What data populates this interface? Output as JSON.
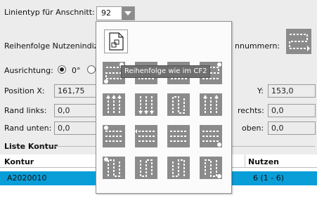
{
  "labels": {
    "linientyp": "Linientyp für Anschnitt:",
    "reihenfolge": "Reihenfolge Nutzenindiz",
    "nummern": "nnummern:",
    "ausrichtung": "Ausrichtung:",
    "radio_0": "0°",
    "position_x": "Position X:",
    "y": "Y:",
    "rand_links": "Rand links:",
    "rand_rechts": "rechts:",
    "rand_unten": "Rand unten:",
    "rand_oben": "oben:",
    "liste_kontur": "Liste Kontur"
  },
  "combo": {
    "value": "92"
  },
  "fields": {
    "position_x": "161,75",
    "y": "153,0",
    "rand_links": "0,0",
    "rand_rechts": "0,0",
    "rand_unten": "0,0",
    "rand_oben": "0,0"
  },
  "tooltip": "Reihenfolge wie im CF2",
  "table": {
    "headers": [
      "Kontur",
      "Nutzen"
    ],
    "rows": [
      {
        "kontur": "A2020010",
        "nutzen": "6 (1 - 6)"
      }
    ]
  },
  "colors": {
    "selected_row": "#0a9ed8",
    "tile": "#8b8b8b",
    "accent_combo_btn": "#8c8c8c"
  }
}
